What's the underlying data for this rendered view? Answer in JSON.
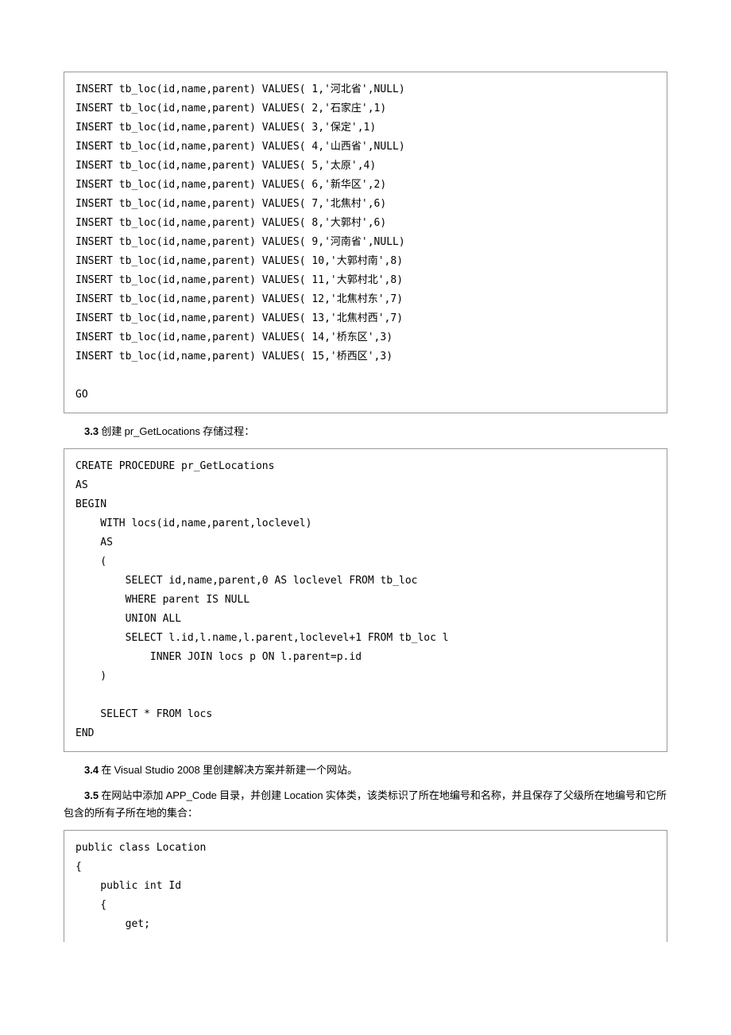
{
  "code_block_1": "INSERT tb_loc(id,name,parent) VALUES( 1,'河北省',NULL)\nINSERT tb_loc(id,name,parent) VALUES( 2,'石家庄',1)\nINSERT tb_loc(id,name,parent) VALUES( 3,'保定',1)\nINSERT tb_loc(id,name,parent) VALUES( 4,'山西省',NULL)\nINSERT tb_loc(id,name,parent) VALUES( 5,'太原',4)\nINSERT tb_loc(id,name,parent) VALUES( 6,'新华区',2)\nINSERT tb_loc(id,name,parent) VALUES( 7,'北焦村',6)\nINSERT tb_loc(id,name,parent) VALUES( 8,'大郭村',6)\nINSERT tb_loc(id,name,parent) VALUES( 9,'河南省',NULL)\nINSERT tb_loc(id,name,parent) VALUES( 10,'大郭村南',8)\nINSERT tb_loc(id,name,parent) VALUES( 11,'大郭村北',8)\nINSERT tb_loc(id,name,parent) VALUES( 12,'北焦村东',7)\nINSERT tb_loc(id,name,parent) VALUES( 13,'北焦村西',7)\nINSERT tb_loc(id,name,parent) VALUES( 14,'桥东区',3)\nINSERT tb_loc(id,name,parent) VALUES( 15,'桥西区',3)\n\nGO",
  "para_33_num": "3.3",
  "para_33_text_cn1": " 创建 ",
  "para_33_en": "pr_GetLocations",
  "para_33_text_cn2": " 存储过程：",
  "code_block_2": "CREATE PROCEDURE pr_GetLocations\nAS\nBEGIN\n    WITH locs(id,name,parent,loclevel)\n    AS\n    (\n        SELECT id,name,parent,0 AS loclevel FROM tb_loc\n        WHERE parent IS NULL\n        UNION ALL\n        SELECT l.id,l.name,l.parent,loclevel+1 FROM tb_loc l\n            INNER JOIN locs p ON l.parent=p.id\n    )\n    \n    SELECT * FROM locs\nEND",
  "para_34_num": "3.4",
  "para_34_text_cn1": " 在 ",
  "para_34_en": "Visual Studio 2008",
  "para_34_text_cn2": " 里创建解决方案并新建一个网站。",
  "para_35_num": "3.5",
  "para_35_text_cn1": " 在网站中添加 ",
  "para_35_en1": "APP_Code",
  "para_35_text_cn2": " 目录，并创建 ",
  "para_35_en2": "Location",
  "para_35_text_cn3": " 实体类，该类标识了所在地编号和名称，并且保存了父级所在地编号和它所包含的所有子所在地的集合：",
  "code_block_3": "public class Location\n{\n    public int Id\n    {\n        get;"
}
